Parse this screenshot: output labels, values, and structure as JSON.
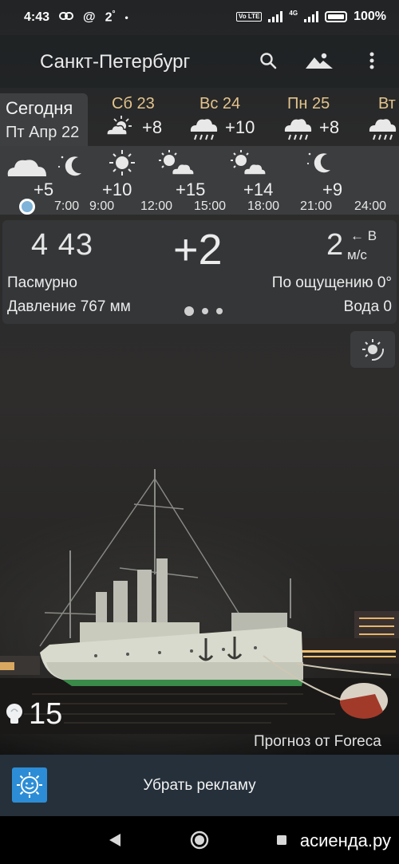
{
  "status": {
    "time": "4:43",
    "temp": "2",
    "degree": "°",
    "dot": "•",
    "volte": "Vo LTE",
    "net": "4G",
    "battery": "100%"
  },
  "app": {
    "city": "Санкт-Петербург"
  },
  "today": {
    "label": "Сегодня",
    "date": "Пт Апр 22"
  },
  "days": [
    {
      "name": "Сб 23",
      "temp": "+8",
      "icon": "cloud-sun-icon"
    },
    {
      "name": "Вс 24",
      "temp": "+10",
      "icon": "cloud-rain-icon"
    },
    {
      "name": "Пн 25",
      "temp": "+8",
      "icon": "cloud-rain-icon"
    },
    {
      "name": "Вт",
      "icon": "cloud-rain-icon"
    }
  ],
  "hourly": [
    {
      "temp": "+5",
      "icon": "cloud-moon-icon"
    },
    {
      "temp": "+10",
      "time": "9:00",
      "icon": "sun-icon"
    },
    {
      "temp": "+15",
      "time": "12:00",
      "icon": "sun-cloud-icon"
    },
    {
      "temp": "+14",
      "time": "15:00",
      "icon": "sun-cloud-icon"
    },
    {
      "temp": "+9",
      "time": "21:00",
      "icon": "moon-icon"
    }
  ],
  "hourly_times": [
    "7:00",
    "18:00",
    "24:00"
  ],
  "current": {
    "time": "4 43",
    "temp": "+2",
    "wind_speed": "2",
    "wind_arrow": "←",
    "wind_dir": "В",
    "wind_unit": "м/с",
    "condition": "Пасмурно",
    "feels_like": "По ощущению 0°",
    "pressure": "Давление 767 мм",
    "water": "Вода 0"
  },
  "uv": {
    "value": "15"
  },
  "credit": "Прогноз от Foreca",
  "ad": {
    "label": "Убрать рекламу"
  },
  "watermark": "асиенда.ру",
  "colors": {
    "day_name": "#e3c48c",
    "ad_bar": "#25303a",
    "ad_icon": "#2c8dd6",
    "now_dot": "#7fb3d8"
  }
}
